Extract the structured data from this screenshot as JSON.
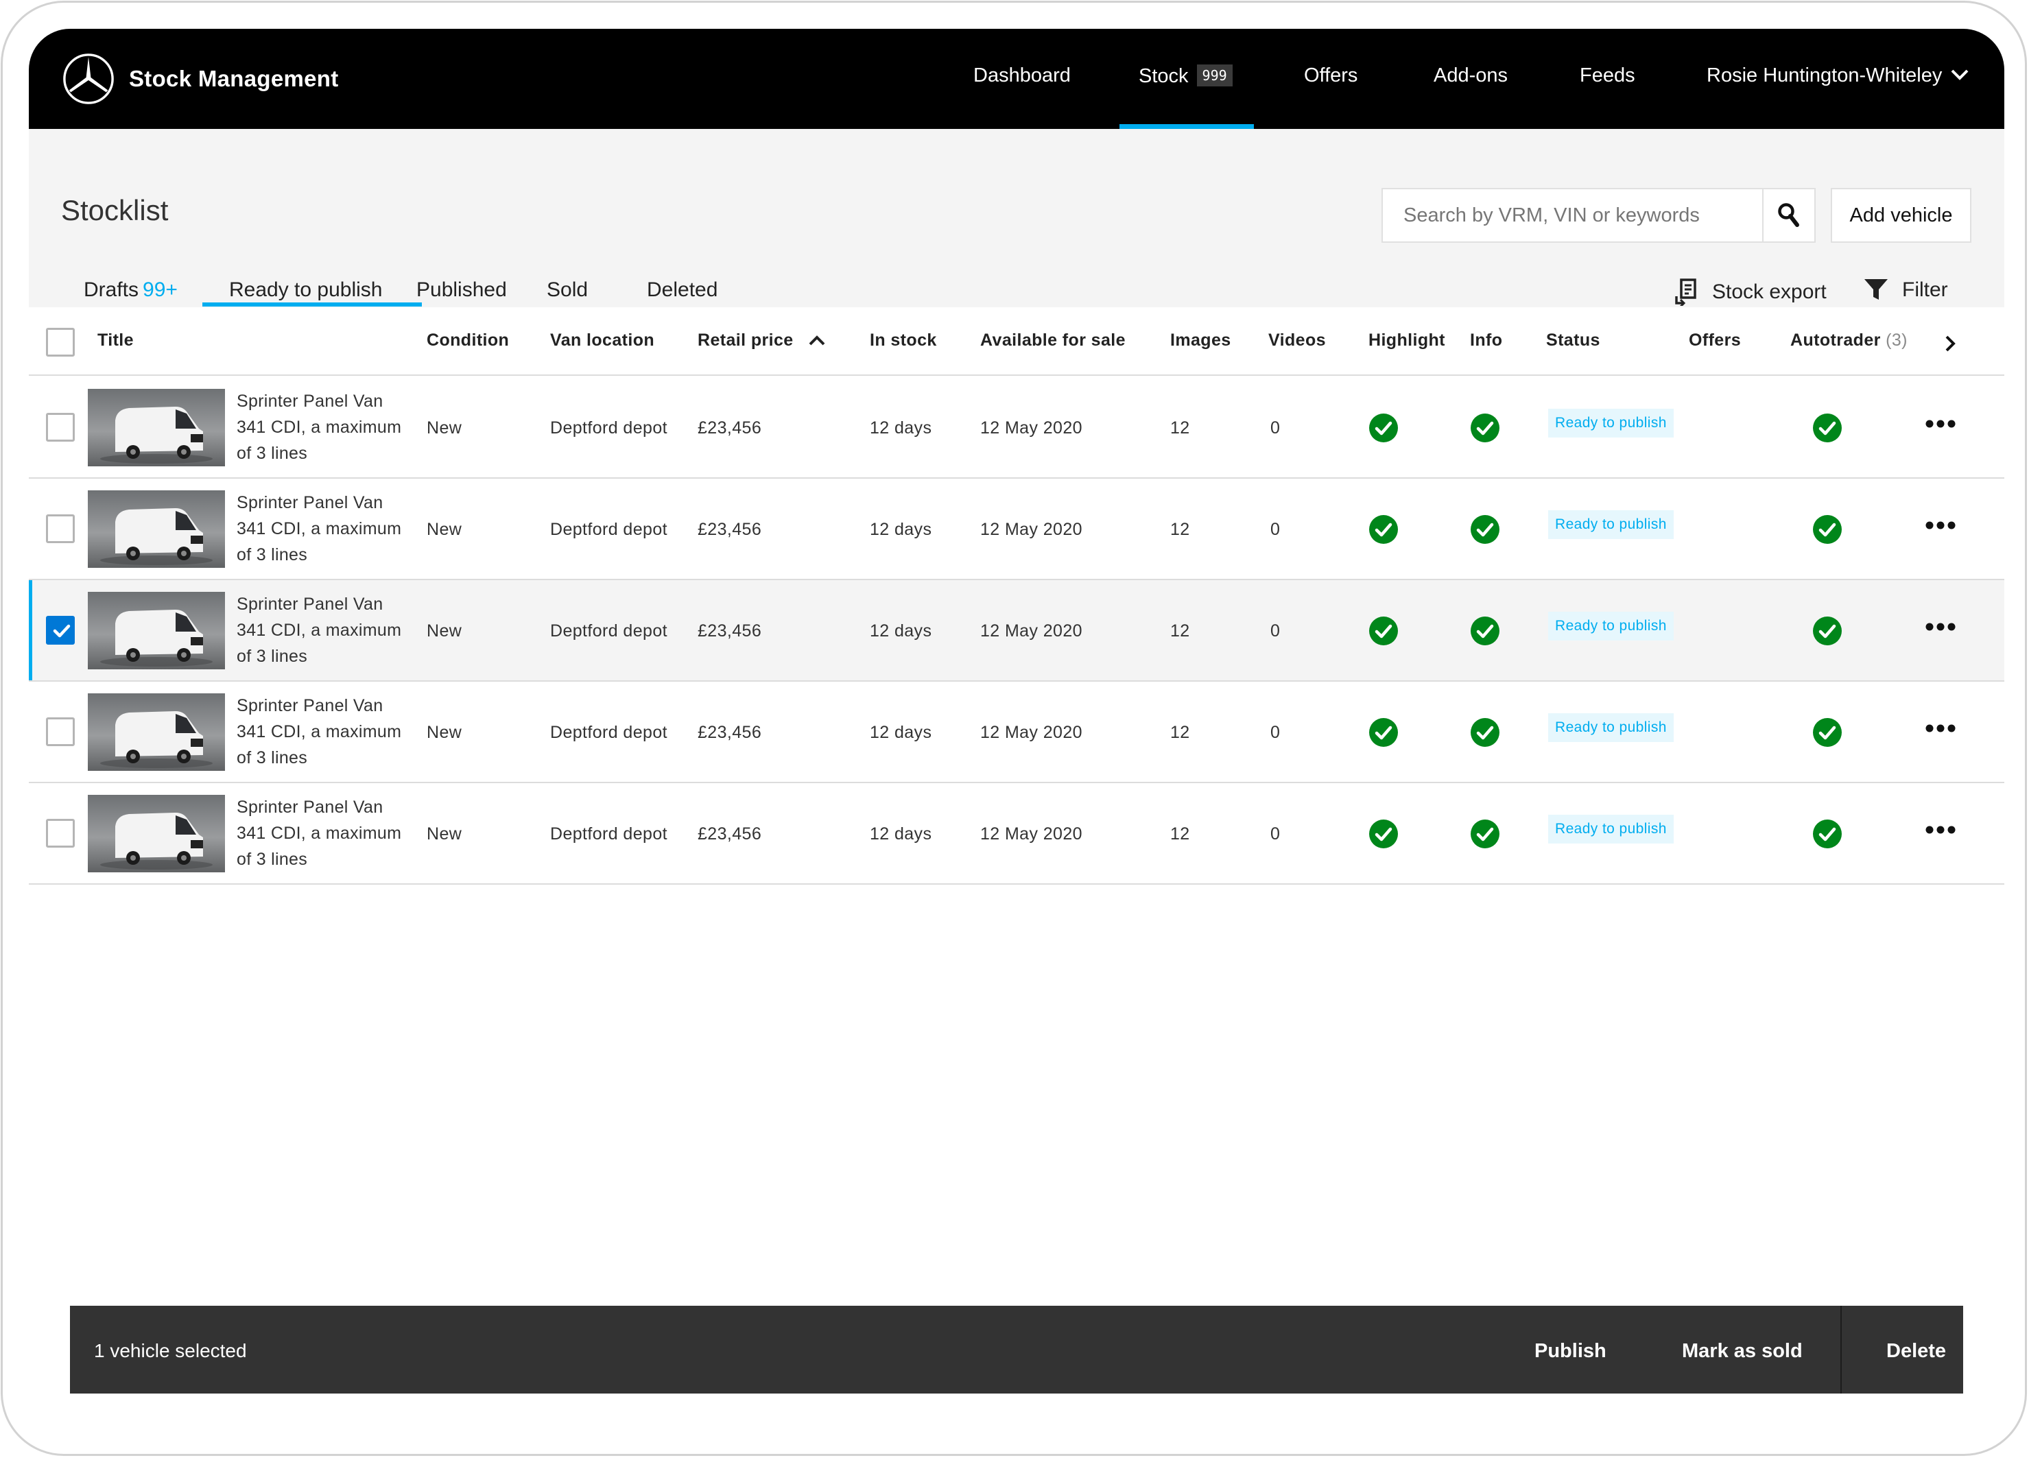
{
  "app": {
    "title": "Stock Management",
    "nav": [
      {
        "label": "Dashboard"
      },
      {
        "label": "Stock",
        "badge": "999"
      },
      {
        "label": "Offers"
      },
      {
        "label": "Add-ons"
      },
      {
        "label": "Feeds"
      }
    ],
    "user": "Rosie Huntington-Whiteley",
    "active_nav": "Stock",
    "colors": {
      "accent": "#00adef",
      "nav_bg": "#000000",
      "success": "#00861a",
      "action_bar": "#333333"
    }
  },
  "page": {
    "title": "Stocklist",
    "search_placeholder": "Search by VRM, VIN or keywords",
    "add_vehicle": "Add vehicle",
    "tabs": [
      {
        "label": "Drafts",
        "count": "99+"
      },
      {
        "label": "Ready to publish"
      },
      {
        "label": "Published"
      },
      {
        "label": "Sold"
      },
      {
        "label": "Deleted"
      }
    ],
    "active_tab": "Ready to publish",
    "stock_export": "Stock export",
    "filter": "Filter"
  },
  "table": {
    "columns": {
      "title": "Title",
      "condition": "Condition",
      "location": "Van location",
      "price": "Retail price",
      "in_stock": "In stock",
      "available": "Available for sale",
      "images": "Images",
      "videos": "Videos",
      "highlight": "Highlight",
      "info": "Info",
      "status": "Status",
      "offers": "Offers",
      "autotrader": "Autotrader",
      "autotrader_count": "(3)"
    },
    "sort": {
      "column": "Retail price",
      "direction": "ascending"
    },
    "rows": [
      {
        "title": "Sprinter Panel Van 341 CDI, a maximum of 3 lines",
        "condition": "New",
        "location": "Deptford depot",
        "price": "£23,456",
        "in_stock": "12 days",
        "available": "12 May 2020",
        "images": "12",
        "videos": "0",
        "highlight": true,
        "info": true,
        "status": "Ready to publish",
        "autotrader": true,
        "selected": false
      },
      {
        "title": "Sprinter Panel Van 341 CDI, a maximum of 3 lines",
        "condition": "New",
        "location": "Deptford depot",
        "price": "£23,456",
        "in_stock": "12 days",
        "available": "12 May 2020",
        "images": "12",
        "videos": "0",
        "highlight": true,
        "info": true,
        "status": "Ready to publish",
        "autotrader": true,
        "selected": false
      },
      {
        "title": "Sprinter Panel Van 341 CDI, a maximum of 3 lines",
        "condition": "New",
        "location": "Deptford depot",
        "price": "£23,456",
        "in_stock": "12 days",
        "available": "12 May 2020",
        "images": "12",
        "videos": "0",
        "highlight": true,
        "info": true,
        "status": "Ready to publish",
        "autotrader": true,
        "selected": true
      },
      {
        "title": "Sprinter Panel Van 341 CDI, a maximum of 3 lines",
        "condition": "New",
        "location": "Deptford depot",
        "price": "£23,456",
        "in_stock": "12 days",
        "available": "12 May 2020",
        "images": "12",
        "videos": "0",
        "highlight": true,
        "info": true,
        "status": "Ready to publish",
        "autotrader": true,
        "selected": false
      },
      {
        "title": "Sprinter Panel Van 341 CDI, a maximum of 3 lines",
        "condition": "New",
        "location": "Deptford depot",
        "price": "£23,456",
        "in_stock": "12 days",
        "available": "12 May 2020",
        "images": "12",
        "videos": "0",
        "highlight": true,
        "info": true,
        "status": "Ready to publish",
        "autotrader": true,
        "selected": false
      }
    ]
  },
  "action_bar": {
    "selected_text": "1 vehicle selected",
    "publish": "Publish",
    "mark_sold": "Mark as sold",
    "delete": "Delete"
  }
}
